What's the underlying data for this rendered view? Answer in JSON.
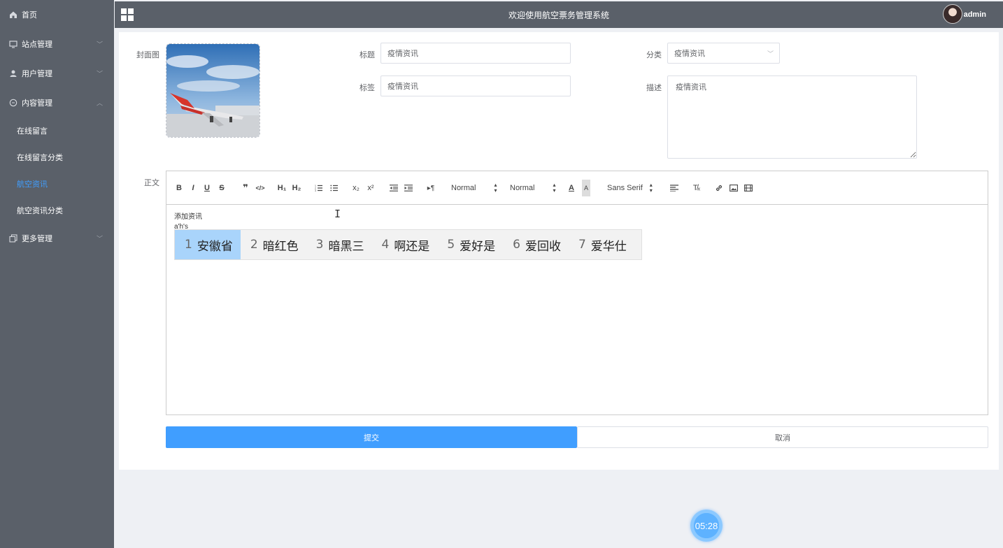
{
  "app": {
    "title": "欢迎使用航空票务管理系统",
    "user": "admin"
  },
  "sidebar": {
    "items": [
      {
        "label": "首页",
        "icon": "home-icon"
      },
      {
        "label": "站点管理",
        "icon": "monitor-icon"
      },
      {
        "label": "用户管理",
        "icon": "user-icon"
      },
      {
        "label": "内容管理",
        "icon": "chat-icon"
      },
      {
        "label": "更多管理",
        "icon": "copy-icon"
      }
    ],
    "sub_items": [
      {
        "label": "在线留言",
        "active": false
      },
      {
        "label": "在线留言分类",
        "active": false
      },
      {
        "label": "航空资讯",
        "active": true
      },
      {
        "label": "航空资讯分类",
        "active": false
      }
    ]
  },
  "form": {
    "cover_label": "封面图",
    "title_label": "标题",
    "title_value": "疫情资讯",
    "category_label": "分类",
    "category_value": "疫情资讯",
    "tag_label": "标签",
    "tag_value": "疫情资讯",
    "desc_label": "描述",
    "desc_value": "疫情资讯",
    "body_label": "正文"
  },
  "editor": {
    "toolbar": {
      "bold": "B",
      "italic": "I",
      "underline": "U",
      "strike": "S",
      "quote": "❞",
      "code": "</>",
      "h1": "H₁",
      "h2": "H₂",
      "subscript": "x₂",
      "superscript": "x²",
      "header_picker": "Normal",
      "size_picker": "Normal",
      "font_picker": "Sans Serif",
      "clean": "T̸ₓ"
    },
    "lines": [
      "添加资讯",
      "a'h's"
    ]
  },
  "ime": {
    "candidates": [
      {
        "n": "1",
        "text": "安徽省",
        "selected": true
      },
      {
        "n": "2",
        "text": "暗红色",
        "selected": false
      },
      {
        "n": "3",
        "text": "暗黑三",
        "selected": false
      },
      {
        "n": "4",
        "text": "啊还是",
        "selected": false
      },
      {
        "n": "5",
        "text": "爱好是",
        "selected": false
      },
      {
        "n": "6",
        "text": "爱回收",
        "selected": false
      },
      {
        "n": "7",
        "text": "爱华仕",
        "selected": false
      }
    ]
  },
  "buttons": {
    "submit": "提交",
    "cancel": "取消"
  },
  "timer": "05:28",
  "colors": {
    "sidebar": "#5a6069",
    "accent": "#409eff",
    "ime_selected": "#a9d4fb"
  }
}
